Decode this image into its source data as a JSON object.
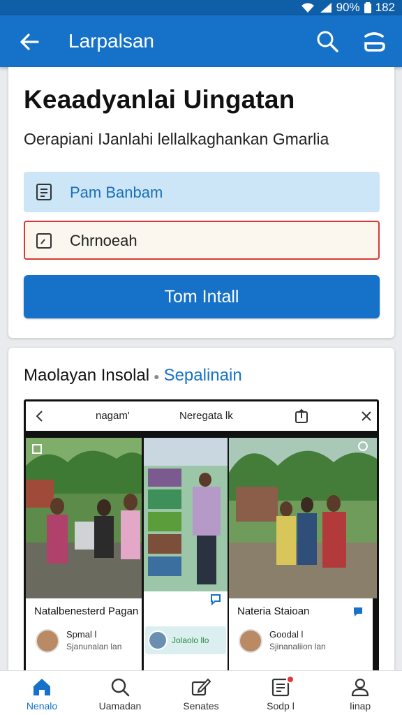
{
  "status_bar": {
    "battery_text": "90%",
    "time": "182"
  },
  "app_bar": {
    "title": "Larpalsan",
    "icons": [
      "back-arrow-icon",
      "search-icon",
      "menu-icon"
    ]
  },
  "form_card": {
    "heading": "Keaadyanlai Uingatan",
    "subtitle": "Oerapiani IJanlahi lellalkaghankan Gmarlia",
    "blue_field_text": "Pam Banbam",
    "red_field_text": "Chrnoeah",
    "install_button": "Tom Intall"
  },
  "preview_card": {
    "title": "Maolayan Insolal",
    "link": "Sepalinain",
    "preview": {
      "tab1": "nagam'",
      "tab2": "Neregata lk",
      "left_card": {
        "title": "Natalbenesterd Pagan",
        "user": "Spmal l",
        "meta": "Sjanunalan lan"
      },
      "right_card": {
        "title": "Nateria Staioan",
        "user": "Goodal l",
        "meta": "Sjinanaliion lan"
      },
      "middle_chip": "Jolaolo llo"
    }
  },
  "bottom_nav": {
    "items": [
      {
        "label": "Nenalo",
        "icon": "home-icon"
      },
      {
        "label": "Uamadan",
        "icon": "search-icon"
      },
      {
        "label": "Senates",
        "icon": "edit-icon"
      },
      {
        "label": "Sodp l",
        "icon": "document-icon"
      },
      {
        "label": "Iinap",
        "icon": "profile-icon"
      }
    ]
  },
  "colors": {
    "primary": "#1672c9",
    "status_bar": "#0e5ea8",
    "field_blue": "#cde6f7",
    "error_red": "#d83a36",
    "badge_red": "#e53935"
  }
}
